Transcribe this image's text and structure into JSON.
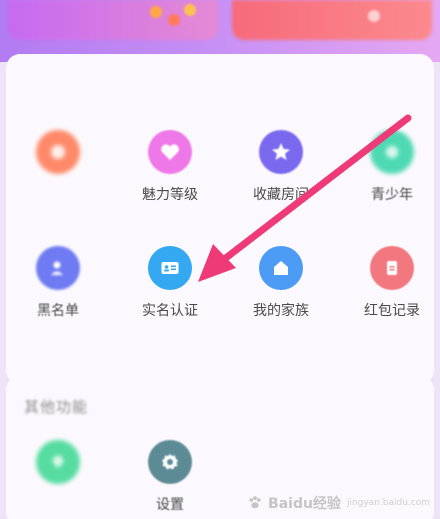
{
  "sections": {
    "main_title": "",
    "other_title": "其他功能"
  },
  "features": [
    {
      "label": "",
      "icon": "orange-badge-icon",
      "color": "#ff8a6a"
    },
    {
      "label": "魅力等级",
      "icon": "heart-icon",
      "color": "#ef78e8"
    },
    {
      "label": "收藏房间",
      "icon": "star-icon",
      "color": "#7a68ef"
    },
    {
      "label": "青少年",
      "icon": "teen-mode-icon",
      "color": "#4fd9b2"
    },
    {
      "label": "黑名单",
      "icon": "blacklist-user-icon",
      "color": "#6e7bf2"
    },
    {
      "label": "实名认证",
      "icon": "id-card-icon",
      "color": "#34a9f2"
    },
    {
      "label": "我的家族",
      "icon": "house-icon",
      "color": "#4c9cf6"
    },
    {
      "label": "红包记录",
      "icon": "red-envelope-icon",
      "color": "#f2777e"
    }
  ],
  "other_features": [
    {
      "label": "",
      "icon": "green-shield-icon",
      "color": "#56dca0"
    },
    {
      "label": "设置",
      "icon": "gear-icon",
      "color": "#5c8b95"
    }
  ],
  "annotation": {
    "arrow_color": "#ef3a78"
  },
  "watermark": {
    "brand": "Baidu经验",
    "sub": "jingyan.baidu.com"
  }
}
